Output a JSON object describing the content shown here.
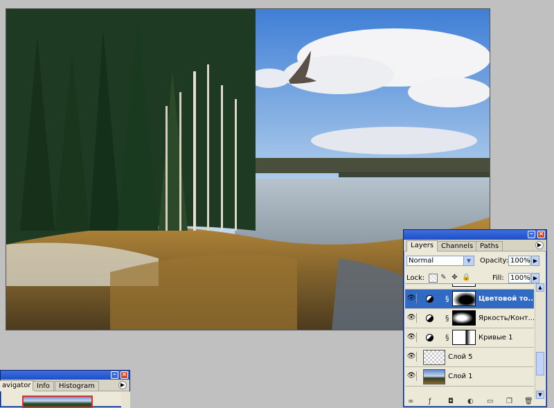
{
  "layers_panel": {
    "tabs": [
      "Layers",
      "Channels",
      "Paths"
    ],
    "blend_mode": "Normal",
    "opacity_label": "Opacity:",
    "opacity_value": "100%",
    "lock_label": "Lock:",
    "fill_label": "Fill:",
    "fill_value": "100%",
    "layers": [
      {
        "name": "Цветовой то...",
        "selected": true
      },
      {
        "name": "Яркость/Конт...",
        "selected": false
      },
      {
        "name": "Кривые 1",
        "selected": false
      },
      {
        "name": "Слой 5",
        "selected": false
      },
      {
        "name": "Слой 1",
        "selected": false
      }
    ]
  },
  "navigator_panel": {
    "tabs": [
      "avigator",
      "Info",
      "Histogram"
    ]
  },
  "icons": {
    "visibility": "eye-icon",
    "adjustment": "adjustment-layer-icon",
    "link": "chain-link-icon",
    "minimize": "minimize-icon",
    "close": "close-icon",
    "palette_menu": "palette-menu-arrow-icon"
  },
  "colors": {
    "title_bar": "#1f4fc6",
    "selection": "#316ac5",
    "panel_bg": "#ece9d8",
    "close_button": "#d9442c"
  }
}
